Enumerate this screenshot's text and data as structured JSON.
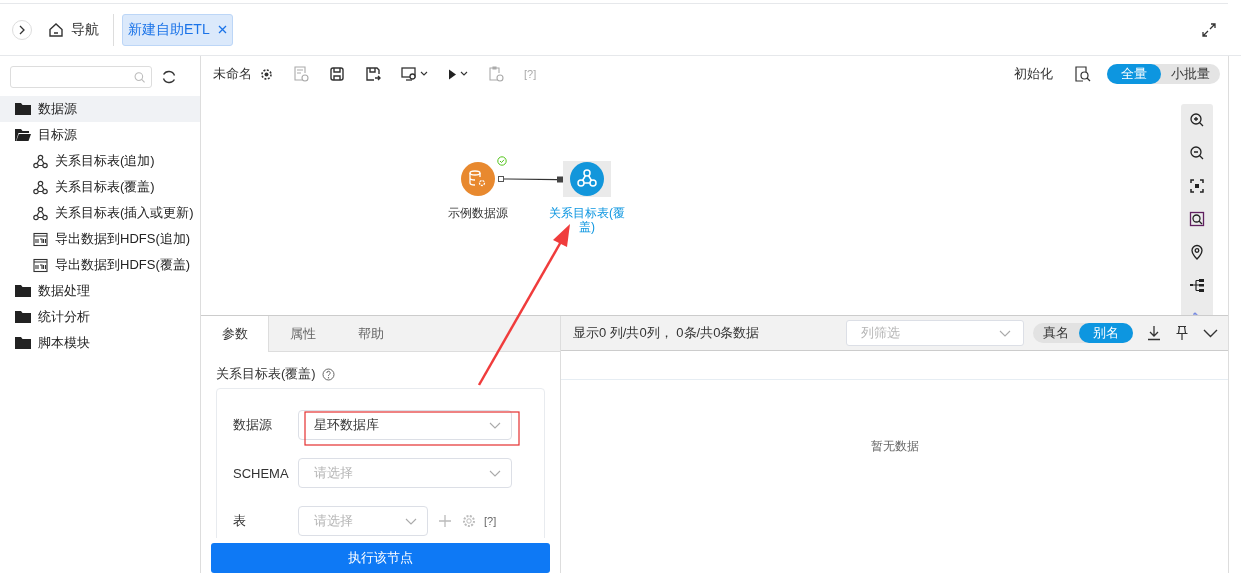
{
  "top_bar": {
    "nav_label": "导航",
    "tabs": [
      {
        "label": "新建自助ETL",
        "selected": true
      }
    ]
  },
  "sidebar": {
    "items": [
      {
        "label": "数据源",
        "expanded": false,
        "selected": true
      },
      {
        "label": "目标源",
        "expanded": true,
        "selected": false,
        "children": [
          {
            "label": "关系目标表(追加)",
            "kind": "relation",
            "selected": false
          },
          {
            "label": "关系目标表(覆盖)",
            "kind": "relation",
            "selected": false
          },
          {
            "label": "关系目标表(插入或更新)",
            "kind": "relation",
            "selected": false
          },
          {
            "label": "导出数据到HDFS(追加)",
            "kind": "hdfs",
            "selected": false
          },
          {
            "label": "导出数据到HDFS(覆盖)",
            "kind": "hdfs",
            "selected": false
          }
        ]
      },
      {
        "label": "数据处理",
        "expanded": false,
        "selected": false
      },
      {
        "label": "统计分析",
        "expanded": false,
        "selected": false
      },
      {
        "label": "脚本模块",
        "expanded": false,
        "selected": false
      }
    ]
  },
  "toolbar": {
    "name": "未命名",
    "help_mark": "[?]",
    "init_label": "初始化",
    "modes": [
      {
        "label": "全量",
        "selected": true
      },
      {
        "label": "小批量",
        "selected": false
      }
    ]
  },
  "canvas": {
    "nodes": [
      {
        "label": "示例数据源",
        "kind": "source",
        "status_ok": true,
        "selected": false
      },
      {
        "label": "关系目标表(覆盖)",
        "kind": "target",
        "status_ok": false,
        "selected": true
      }
    ]
  },
  "params_panel": {
    "tabs": [
      {
        "label": "参数",
        "selected": true
      },
      {
        "label": "属性",
        "selected": false
      },
      {
        "label": "帮助",
        "selected": false
      }
    ],
    "title": "关系目标表(覆盖)",
    "fields": [
      {
        "label": "数据源",
        "kind": "select",
        "value": "星环数据库"
      },
      {
        "label": "SCHEMA",
        "kind": "select",
        "placeholder": "请选择"
      },
      {
        "label": "表",
        "kind": "table",
        "placeholder": "请选择",
        "help_mark": "[?]"
      }
    ],
    "run_button": "执行该节点"
  },
  "data_panel": {
    "summary": "显示0 列/共0列， 0条/共0条数据",
    "filter": {
      "placeholder": "列筛选"
    },
    "name_modes": [
      {
        "label": "真名",
        "selected": false
      },
      {
        "label": "别名",
        "selected": true
      }
    ],
    "empty_text": "暂无数据"
  }
}
